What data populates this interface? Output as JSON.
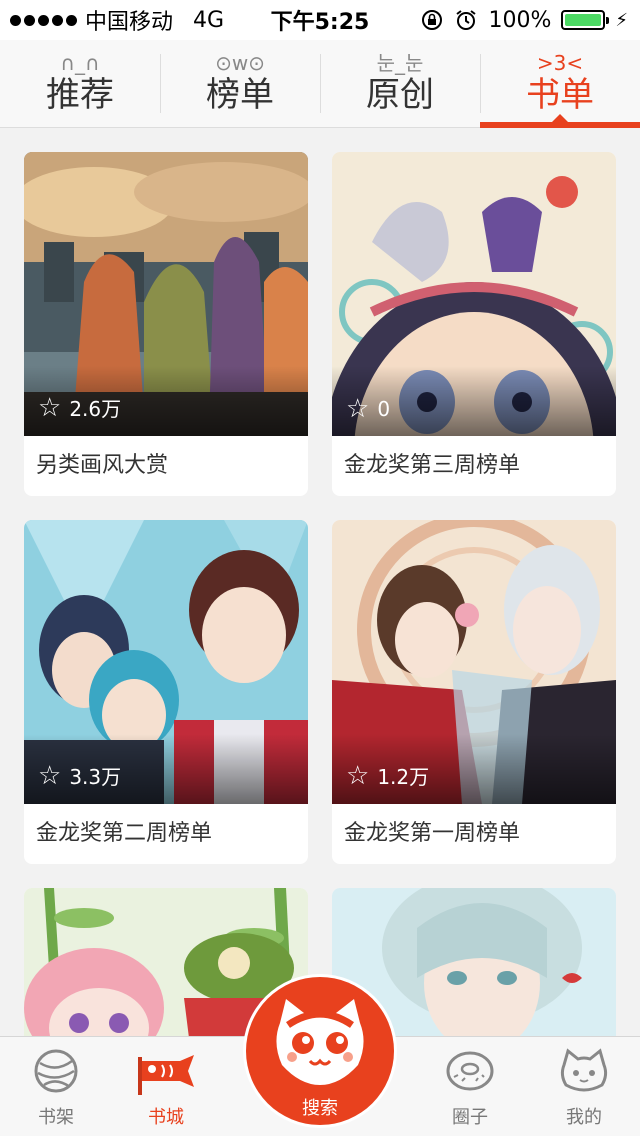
{
  "status_bar": {
    "carrier": "中国移动",
    "network": "4G",
    "time": "下午5:25",
    "battery_text": "100%",
    "battery_level": 1.0,
    "battery_color": "#4cd964"
  },
  "tabs": [
    {
      "emote": "∩_∩",
      "label": "推荐",
      "active": false
    },
    {
      "emote": "⊙w⊙",
      "label": "榜单",
      "active": false
    },
    {
      "emote": "눈_눈",
      "label": "原创",
      "active": false
    },
    {
      "emote": ">3<",
      "label": "书单",
      "active": true
    }
  ],
  "cards": [
    {
      "favorites": "2.6万",
      "title": "另类画风大赏"
    },
    {
      "favorites": "0",
      "title": "金龙奖第三周榜单"
    },
    {
      "favorites": "3.3万",
      "title": "金龙奖第二周榜单"
    },
    {
      "favorites": "1.2万",
      "title": "金龙奖第一周榜单"
    },
    {
      "favorites": "",
      "title": ""
    },
    {
      "favorites": "",
      "title": ""
    }
  ],
  "bottom_nav": {
    "items": [
      {
        "label": "书架",
        "icon": "yarn-ball-icon",
        "active": false
      },
      {
        "label": "书城",
        "icon": "fish-flag-icon",
        "active": true
      },
      {
        "label": "圈子",
        "icon": "donut-icon",
        "active": false
      },
      {
        "label": "我的",
        "icon": "cat-face-icon",
        "active": false
      }
    ],
    "search_label": "搜索",
    "search_icon": "cat-search-icon"
  },
  "colors": {
    "accent": "#e8411e",
    "background": "#f2f2f2",
    "card": "#ffffff"
  }
}
